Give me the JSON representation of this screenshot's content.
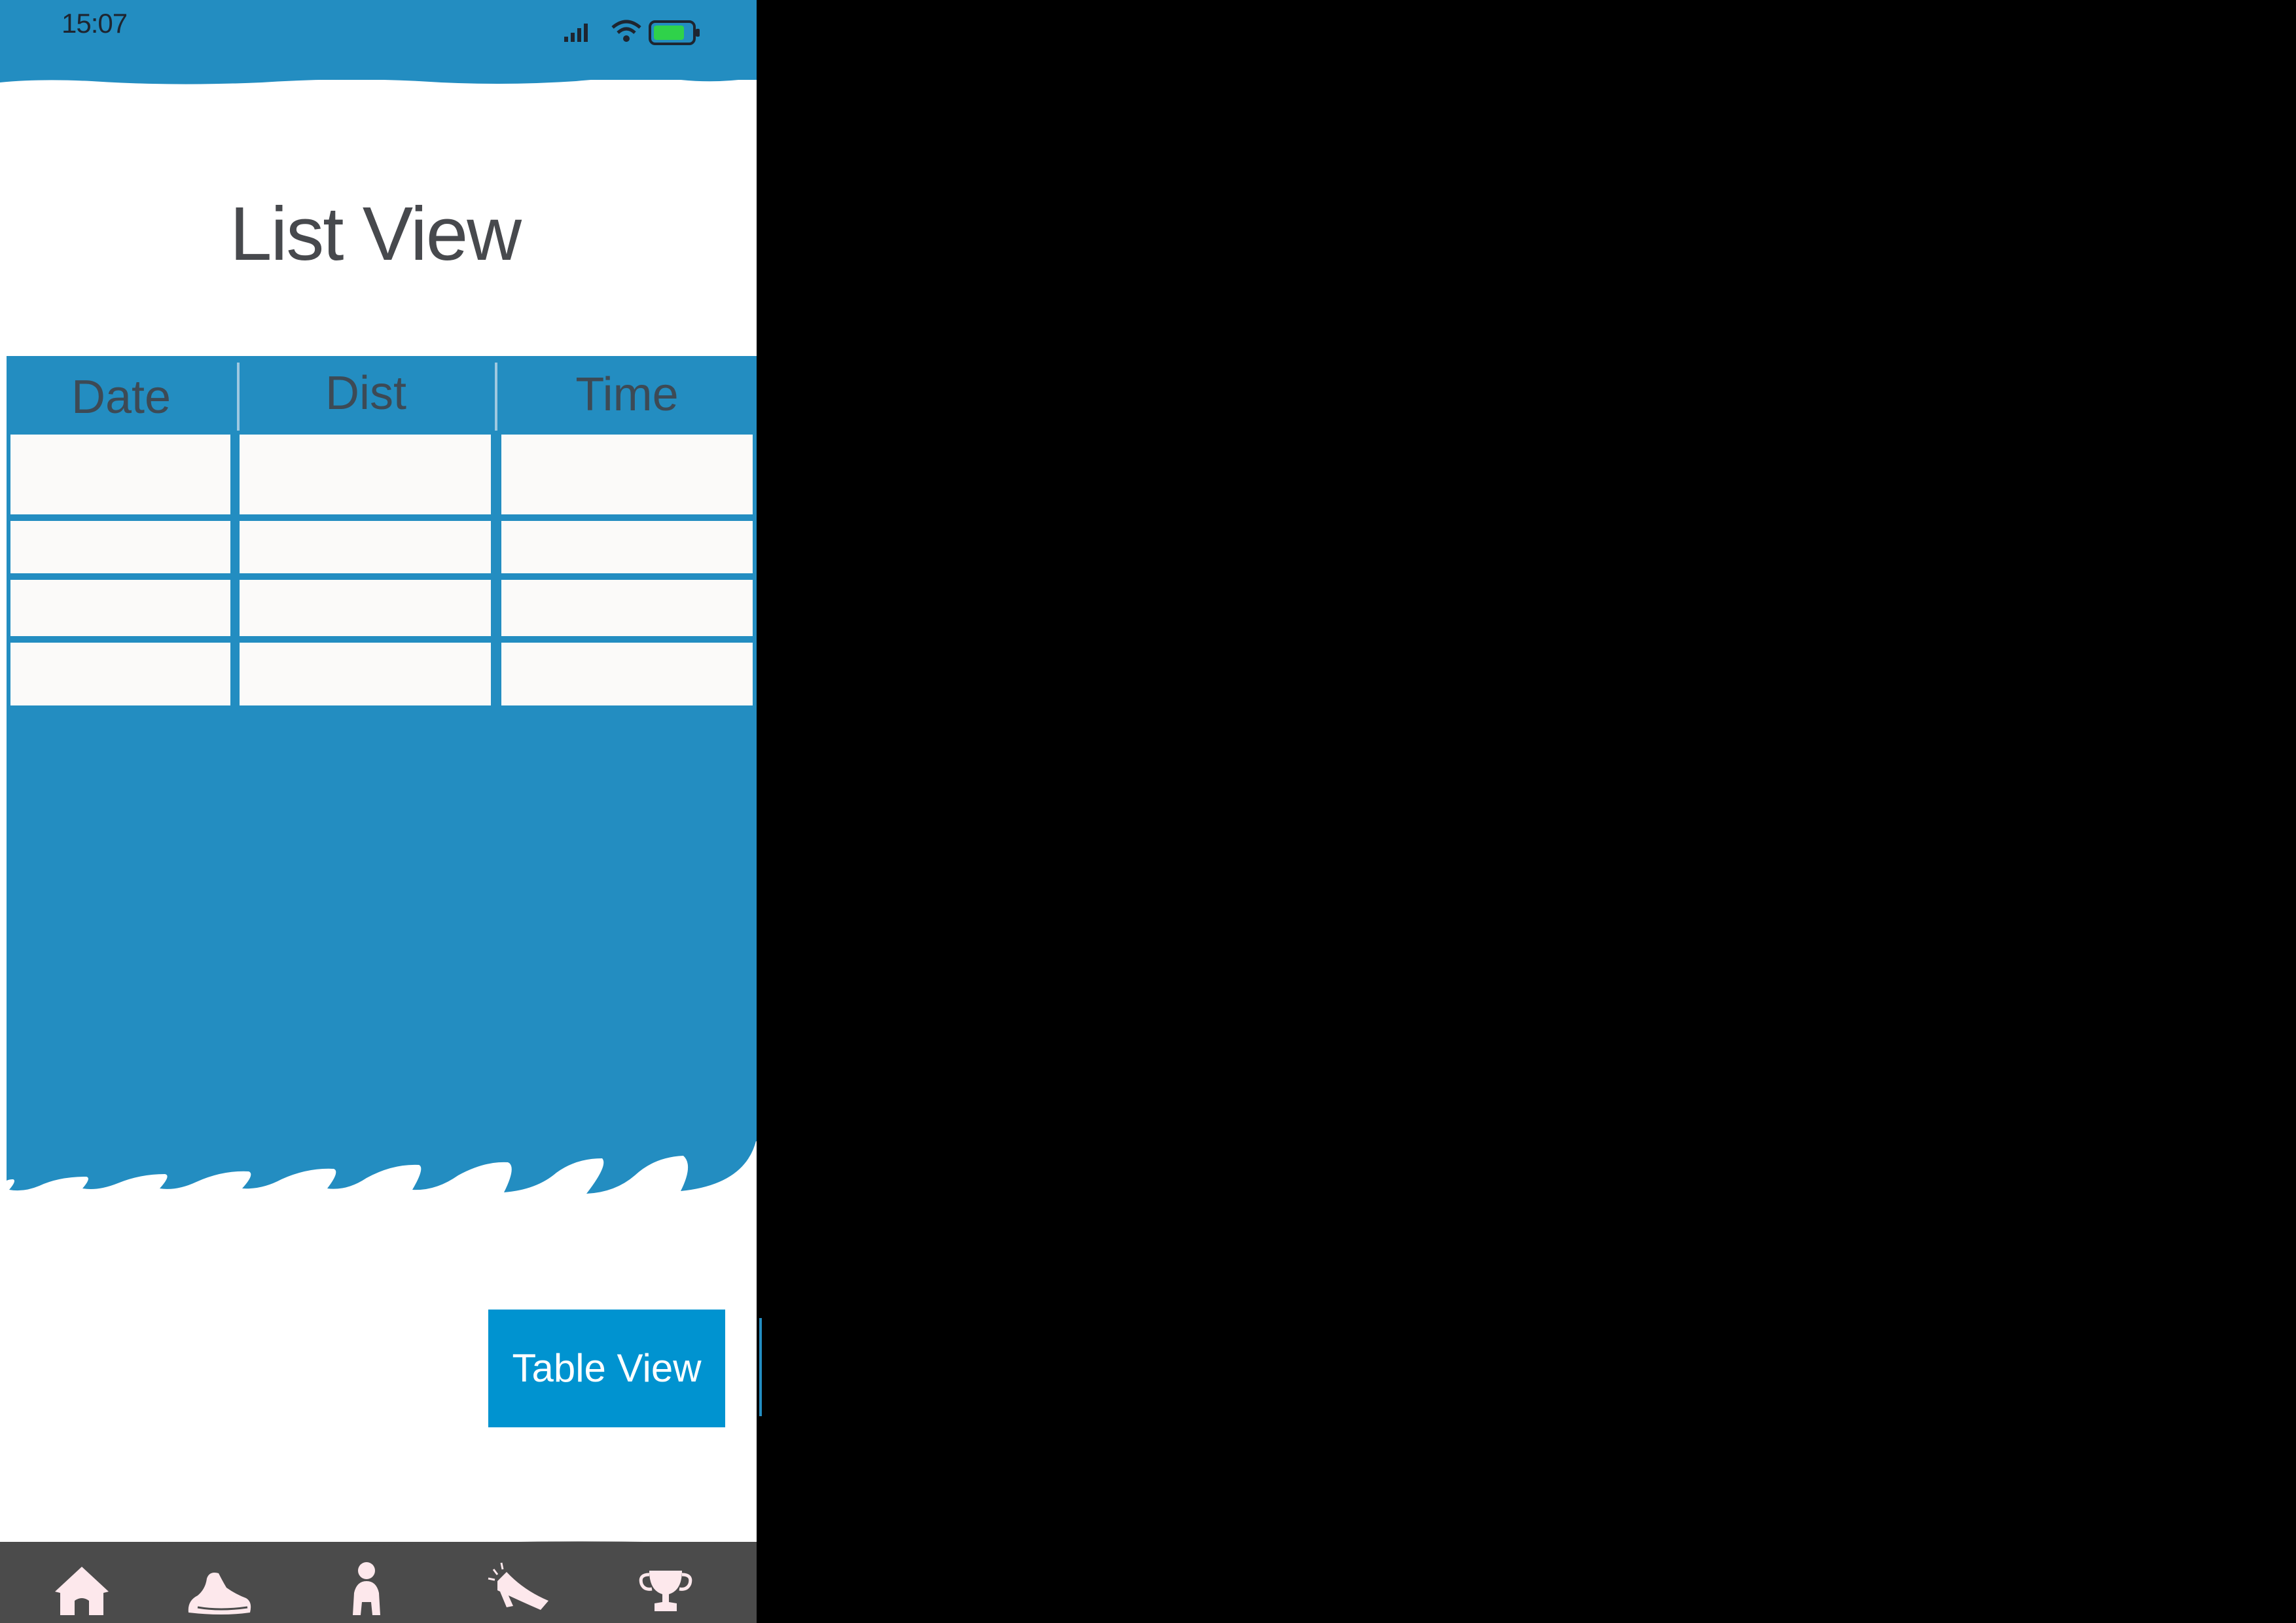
{
  "status_bar": {
    "time": "15:07",
    "icons": [
      "cellular-signal-icon",
      "wifi-icon",
      "battery-icon"
    ],
    "battery_color": "#2fd24a"
  },
  "page": {
    "title": "List View"
  },
  "table": {
    "columns": [
      "Date",
      "Dist",
      "Time"
    ],
    "rows": [
      [
        "",
        "",
        ""
      ],
      [
        "",
        "",
        ""
      ],
      [
        "",
        "",
        ""
      ],
      [
        "",
        "",
        ""
      ]
    ]
  },
  "actions": {
    "table_view_label": "Table View"
  },
  "tab_bar": {
    "items": [
      {
        "icon": "home-icon"
      },
      {
        "icon": "running-shoe-icon"
      },
      {
        "icon": "person-icon"
      },
      {
        "icon": "megaphone-icon"
      },
      {
        "icon": "trophy-icon"
      }
    ]
  },
  "colors": {
    "primary_blue": "#238dc1",
    "button_blue": "#0093d0",
    "tab_bar": "#4b4b4b",
    "title_text": "#47494d",
    "background": "#000000"
  }
}
